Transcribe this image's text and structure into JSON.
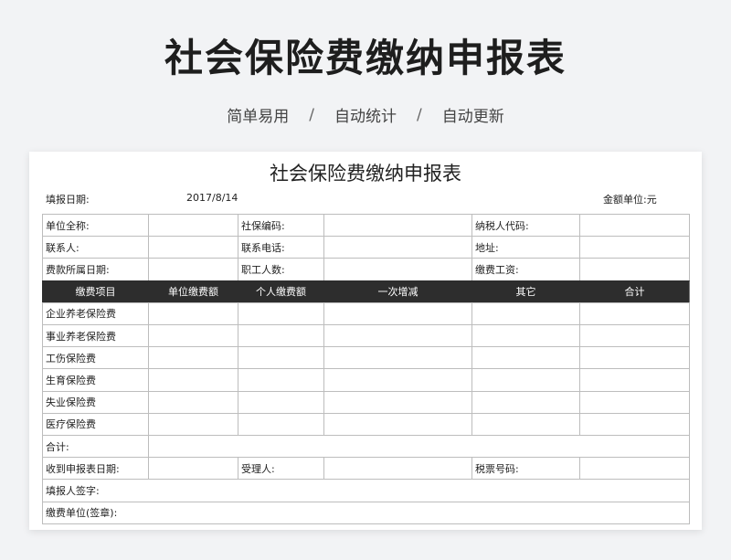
{
  "header": {
    "title": "社会保险费缴纳申报表",
    "features": [
      "简单易用",
      "自动统计",
      "自动更新"
    ],
    "separator": "/"
  },
  "form": {
    "title": "社会保险费缴纳申报表",
    "fill_date_label": "填报日期:",
    "fill_date_value": "2017/8/14",
    "unit_label": "金额单位:元",
    "info_rows": [
      [
        "单位全称:",
        "社保编码:",
        "纳税人代码:"
      ],
      [
        "联系人:",
        "联系电话:",
        "地址:"
      ],
      [
        "费款所属日期:",
        "职工人数:",
        "缴费工资:"
      ]
    ],
    "columns": [
      "缴费项目",
      "单位缴费额",
      "个人缴费额",
      "一次增减",
      "其它",
      "合计"
    ],
    "items": [
      "企业养老保险费",
      "事业养老保险费",
      "工伤保险费",
      "生育保险费",
      "失业保险费",
      "医疗保险费"
    ],
    "total_label": "合计:",
    "receive_date_label": "收到申报表日期:",
    "handler_label": "受理人:",
    "ticket_no_label": "税票号码:",
    "filler_sign_label": "填报人签字:",
    "payer_sign_label": "缴费单位(签章):"
  }
}
